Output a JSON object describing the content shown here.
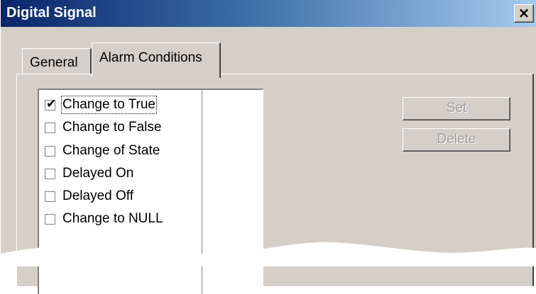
{
  "window": {
    "title": "Digital Signal",
    "close_glyph": "×",
    "close_icon": "close-icon"
  },
  "tabs": [
    {
      "label": "General",
      "selected": false
    },
    {
      "label": "Alarm Conditions",
      "selected": true
    }
  ],
  "alarm_conditions": {
    "items": [
      {
        "label": "Change to True",
        "checked": true,
        "focused": true
      },
      {
        "label": "Change to False",
        "checked": false
      },
      {
        "label": "Change of State",
        "checked": false
      },
      {
        "label": "Delayed On",
        "checked": false
      },
      {
        "label": "Delayed Off",
        "checked": false
      },
      {
        "label": "Change to NULL",
        "checked": false
      }
    ],
    "check_glyph": "✔"
  },
  "buttons": {
    "set_label": "Set",
    "delete_label": "Delete",
    "enabled": false
  },
  "colors": {
    "titlebar_start": "#0a246a",
    "titlebar_end": "#a6caf0",
    "face": "#d4d0c8",
    "disabled_text": "#a0a0a0"
  }
}
